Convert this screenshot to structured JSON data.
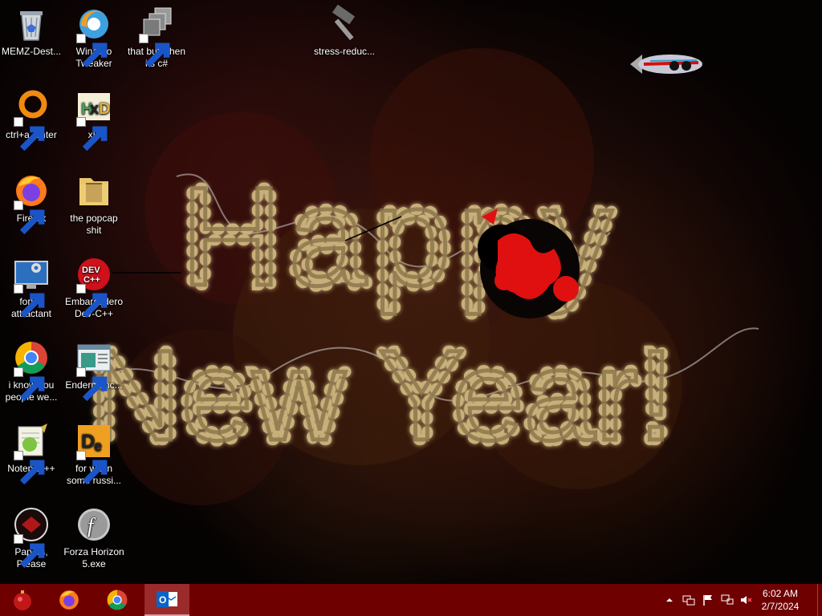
{
  "desktop": {
    "icons": [
      {
        "label": "MEMZ-Dest...",
        "icon": "recycle-bin-icon"
      },
      {
        "label": "Winaero Tweaker",
        "icon": "winaero-icon"
      },
      {
        "label": "that but when its c#",
        "icon": "windows-stack-icon"
      },
      {
        "label": "stress-reduc...",
        "icon": "hammer-icon"
      },
      {
        "label": "ctrl+a, enter",
        "icon": "orange-ring-icon"
      },
      {
        "label": "xD",
        "icon": "hxd-icon"
      },
      {
        "label": "Firefox",
        "icon": "firefox-icon"
      },
      {
        "label": "the popcap shit",
        "icon": "folder-icon"
      },
      {
        "label": "forkie attractant",
        "icon": "monitor-gear-icon"
      },
      {
        "label": "Embarcadero Dev-C++",
        "icon": "devcpp-icon"
      },
      {
        "label": "i know you people we...",
        "icon": "chrome-icon"
      },
      {
        "label": "Endermanc...",
        "icon": "window-app-icon"
      },
      {
        "label": "Notepad++",
        "icon": "notepadpp-icon"
      },
      {
        "label": "for when some russi...",
        "icon": "die-icon"
      },
      {
        "label": "Papers, Please",
        "icon": "papers-please-icon"
      },
      {
        "label": "Forza Horizon 5.exe",
        "icon": "flash-icon"
      }
    ]
  },
  "wallpaper": {
    "line1": "Happy",
    "line2": "New Year!",
    "bulb_color": "#ffe9a6",
    "tube_color": "#c8b07a"
  },
  "taskbar": {
    "apps": [
      {
        "name": "start-ornament-icon"
      },
      {
        "name": "firefox-icon"
      },
      {
        "name": "chrome-icon"
      },
      {
        "name": "outlook-icon",
        "active": true
      }
    ],
    "clock": {
      "time": "6:02 AM",
      "date": "2/7/2024"
    },
    "color": "#6e0000"
  }
}
